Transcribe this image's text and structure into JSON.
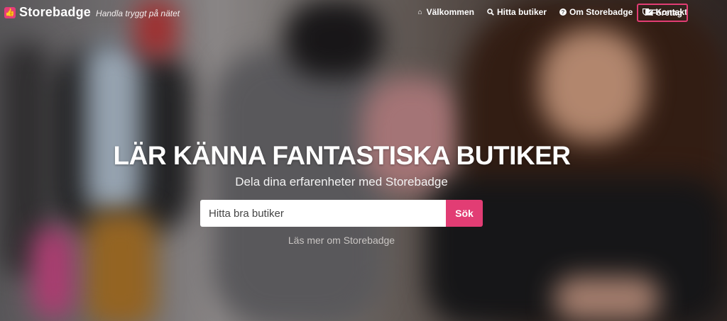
{
  "brand": {
    "name": "Storebadge",
    "tagline": "Handla tryggt på nätet",
    "logo_glyph": "👍"
  },
  "nav": {
    "items": [
      {
        "label": "Välkommen",
        "icon": "home-icon",
        "glyph": "⌂"
      },
      {
        "label": "Hitta butiker",
        "icon": "search-icon",
        "glyph": "🔍"
      },
      {
        "label": "Om Storebadge",
        "icon": "question-icon",
        "glyph": "?"
      },
      {
        "label": "Kontakt",
        "icon": "envelope-icon",
        "glyph": "✉"
      }
    ],
    "company": {
      "label": "Företag",
      "icon": "shield-icon",
      "glyph": "⛉"
    }
  },
  "hero": {
    "title": "LÄR KÄNNA FANTASTISKA BUTIKER",
    "subtitle": "Dela dina erfarenheter med Storebadge",
    "search_placeholder": "Hitta bra butiker",
    "search_button": "Sök",
    "more_link": "Läs mer om Storebadge"
  },
  "colors": {
    "accent": "#e23d74"
  }
}
